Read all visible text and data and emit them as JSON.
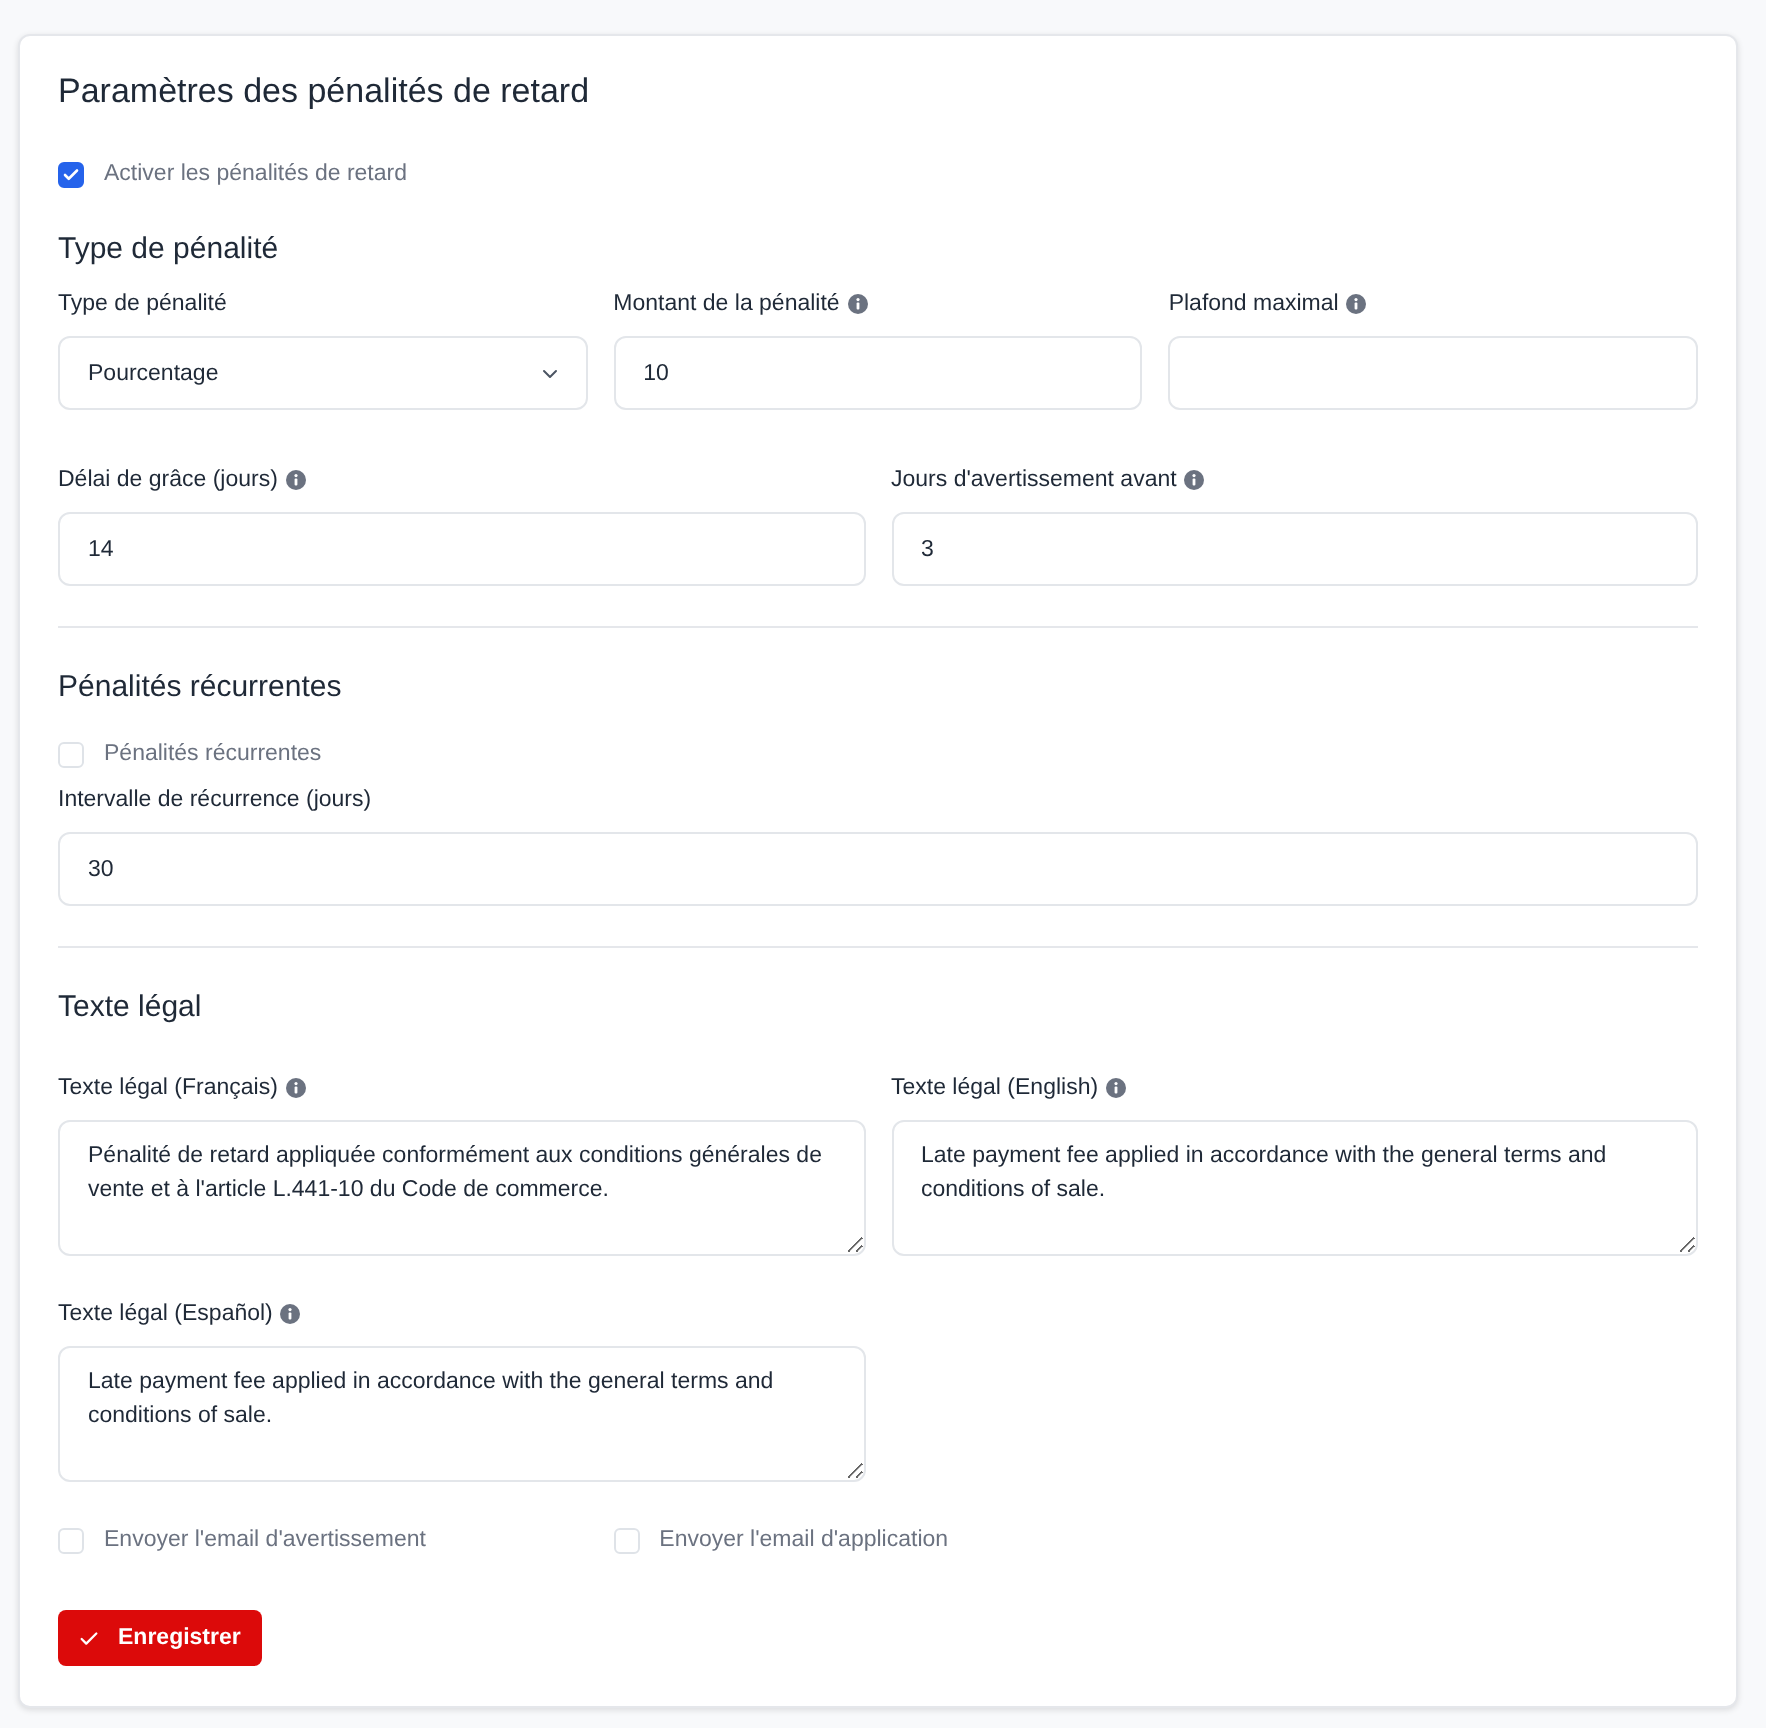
{
  "title": "Paramètres des pénalités de retard",
  "enable_checkbox": {
    "label": "Activer les pénalités de retard",
    "checked": true
  },
  "sections": [
    {
      "kind": "form",
      "heading": "Type de pénalité",
      "rows": [
        [
          {
            "kind": "select",
            "label": "Type de pénalité",
            "value": "Pourcentage",
            "info": false
          },
          {
            "kind": "input",
            "label": "Montant de la pénalité",
            "value": "10",
            "info": true
          },
          {
            "kind": "input",
            "label": "Plafond maximal",
            "info": true
          }
        ],
        [
          {
            "kind": "input",
            "label": "Délai de grâce (jours)",
            "value": "14",
            "info": true
          },
          {
            "kind": "input",
            "label": "Jours d'avertissement avant",
            "value": "3",
            "info": true
          }
        ]
      ]
    },
    {
      "kind": "form",
      "heading": "Pénalités récurrentes",
      "checkbox": {
        "label": "Pénalités récurrentes",
        "checked": false
      },
      "rows": [
        [
          {
            "kind": "input",
            "label": "Intervalle de récurrence (jours)",
            "value": "30",
            "info": false
          }
        ]
      ]
    },
    {
      "kind": "texts",
      "heading": "Texte légal",
      "rows": [
        [
          {
            "kind": "textarea",
            "label": "Texte légal (Français)",
            "value": "Pénalité de retard appliquée conformément aux conditions générales de vente et à l'article L.441-10 du Code de commerce.",
            "info": true
          },
          {
            "kind": "textarea",
            "label": "Texte légal (English)",
            "value": "Late payment fee applied in accordance with the general terms and conditions of sale.",
            "info": true
          }
        ],
        [
          {
            "kind": "textarea",
            "label": "Texte légal (Español)",
            "value": "Late payment fee applied in accordance with the general terms and conditions of sale.",
            "info": true
          }
        ]
      ]
    }
  ],
  "email_checkboxes": [
    {
      "label": "Envoyer l'email d'avertissement",
      "checked": false
    },
    {
      "label": "Envoyer l'email d'application",
      "checked": false
    }
  ],
  "save_button": {
    "label": "Enregistrer"
  }
}
